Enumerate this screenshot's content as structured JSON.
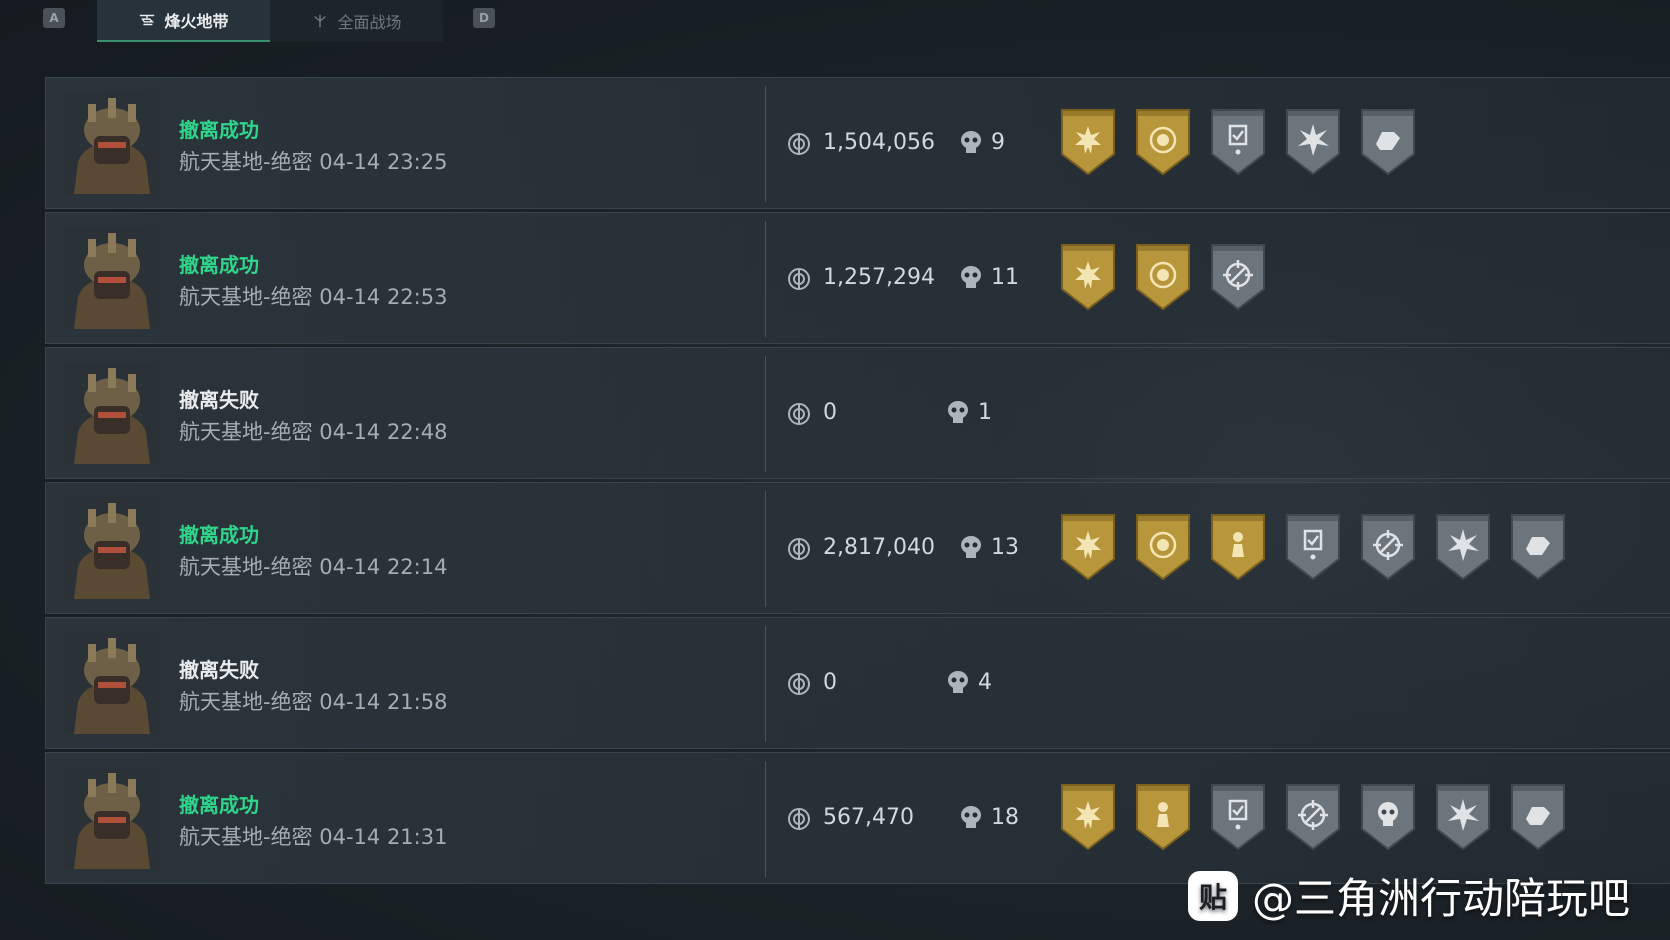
{
  "tabs": {
    "left_key": "A",
    "right_key": "D",
    "items": [
      {
        "label": "烽火地带",
        "icon": "helicopter-icon",
        "active": true
      },
      {
        "label": "全面战场",
        "icon": "soldier-icon",
        "active": false
      }
    ]
  },
  "matches": [
    {
      "status": "撤离成功",
      "success": true,
      "info": "航天基地-绝密 04-14 23:25",
      "value": "1,504,056",
      "kills": "9",
      "medals": [
        "gold-sun-medal-icon",
        "gold-wreath-medal-icon",
        "silver-clipboard-medal-icon",
        "silver-burst-medal-icon",
        "silver-hand-medal-icon"
      ]
    },
    {
      "status": "撤离成功",
      "success": true,
      "info": "航天基地-绝密 04-14 22:53",
      "value": "1,257,294",
      "kills": "11",
      "medals": [
        "gold-sun-medal-icon",
        "gold-wreath-medal-icon",
        "silver-crosshair-medal-icon"
      ]
    },
    {
      "status": "撤离失败",
      "success": false,
      "info": "航天基地-绝密 04-14 22:48",
      "value": "0",
      "kills": "1",
      "medals": []
    },
    {
      "status": "撤离成功",
      "success": true,
      "info": "航天基地-绝密 04-14 22:14",
      "value": "2,817,040",
      "kills": "13",
      "medals": [
        "gold-sun-medal-icon",
        "gold-wreath-medal-icon",
        "gold-figure-medal-icon",
        "silver-clipboard-medal-icon",
        "silver-crosshair-medal-icon",
        "silver-burst-medal-icon",
        "silver-hand-medal-icon"
      ]
    },
    {
      "status": "撤离失败",
      "success": false,
      "info": "航天基地-绝密 04-14 21:58",
      "value": "0",
      "kills": "4",
      "medals": []
    },
    {
      "status": "撤离成功",
      "success": true,
      "info": "航天基地-绝密 04-14 21:31",
      "value": "567,470",
      "kills": "18",
      "medals": [
        "gold-sun-medal-icon",
        "gold-figure-medal-icon",
        "silver-clipboard-medal-icon",
        "silver-crosshair-medal-icon",
        "silver-skull-medal-icon",
        "silver-burst-medal-icon",
        "silver-hand-medal-icon"
      ]
    }
  ],
  "watermark": {
    "logo": "贴",
    "text": "@三角洲行动陪玩吧"
  },
  "colors": {
    "success": "#2fd58a",
    "fail": "#e8ecee",
    "gold": "#b8963c",
    "silver": "#6c757b"
  }
}
